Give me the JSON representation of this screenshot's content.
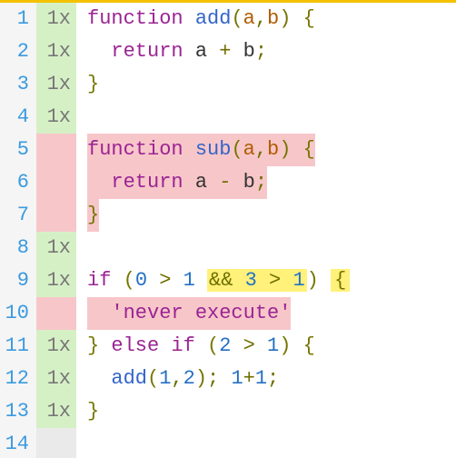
{
  "lines": [
    {
      "n": "1",
      "hits": "1x",
      "cov": "covered"
    },
    {
      "n": "2",
      "hits": "1x",
      "cov": "covered"
    },
    {
      "n": "3",
      "hits": "1x",
      "cov": "covered"
    },
    {
      "n": "4",
      "hits": "1x",
      "cov": "covered"
    },
    {
      "n": "5",
      "hits": "",
      "cov": "uncov"
    },
    {
      "n": "6",
      "hits": "",
      "cov": "uncov"
    },
    {
      "n": "7",
      "hits": "",
      "cov": "uncov"
    },
    {
      "n": "8",
      "hits": "1x",
      "cov": "covered"
    },
    {
      "n": "9",
      "hits": "1x",
      "cov": "covered"
    },
    {
      "n": "10",
      "hits": "",
      "cov": "uncov"
    },
    {
      "n": "11",
      "hits": "1x",
      "cov": "covered"
    },
    {
      "n": "12",
      "hits": "1x",
      "cov": "covered"
    },
    {
      "n": "13",
      "hits": "1x",
      "cov": "covered"
    },
    {
      "n": "14",
      "hits": "",
      "cov": "none"
    }
  ],
  "code": {
    "l1_kw_function": "function",
    "l1_fn": "add",
    "l1_open": "(",
    "l1_p1": "a",
    "l1_comma": ",",
    "l1_p2": "b",
    "l1_close": ")",
    "l1_brace": "{",
    "l2_indent": "  ",
    "l2_kw_return": "return",
    "l2_a": "a",
    "l2_plus": "+",
    "l2_b": "b",
    "l2_semi": ";",
    "l3_brace": "}",
    "l5_kw_function": "function",
    "l5_fn": "sub",
    "l5_open": "(",
    "l5_p1": "a",
    "l5_comma": ",",
    "l5_p2": "b",
    "l5_close": ")",
    "l5_brace": "{",
    "l6_indent": "  ",
    "l6_kw_return": "return",
    "l6_a": "a",
    "l6_minus": "-",
    "l6_b": "b",
    "l6_semi": ";",
    "l7_brace": "}",
    "l9_kw_if": "if",
    "l9_open": "(",
    "l9_0": "0",
    "l9_gt1": ">",
    "l9_1": "1",
    "l9_and": "&&",
    "l9_3": "3",
    "l9_gt2": ">",
    "l9_1b": "1",
    "l9_close": ")",
    "l9_brace": "{",
    "l10_indent": "  ",
    "l10_str": "'never execute'",
    "l11_close_brace": "}",
    "l11_kw_else": "else",
    "l11_kw_if": "if",
    "l11_open": "(",
    "l11_2": "2",
    "l11_gt": ">",
    "l11_1": "1",
    "l11_close": ")",
    "l11_brace": "{",
    "l12_indent": "  ",
    "l12_fn": "add",
    "l12_open": "(",
    "l12_1": "1",
    "l12_comma": ",",
    "l12_2": "2",
    "l12_close": ")",
    "l12_semi1": ";",
    "l12_1b": "1",
    "l12_plus": "+",
    "l12_1c": "1",
    "l12_semi2": ";",
    "l13_brace": "}"
  }
}
